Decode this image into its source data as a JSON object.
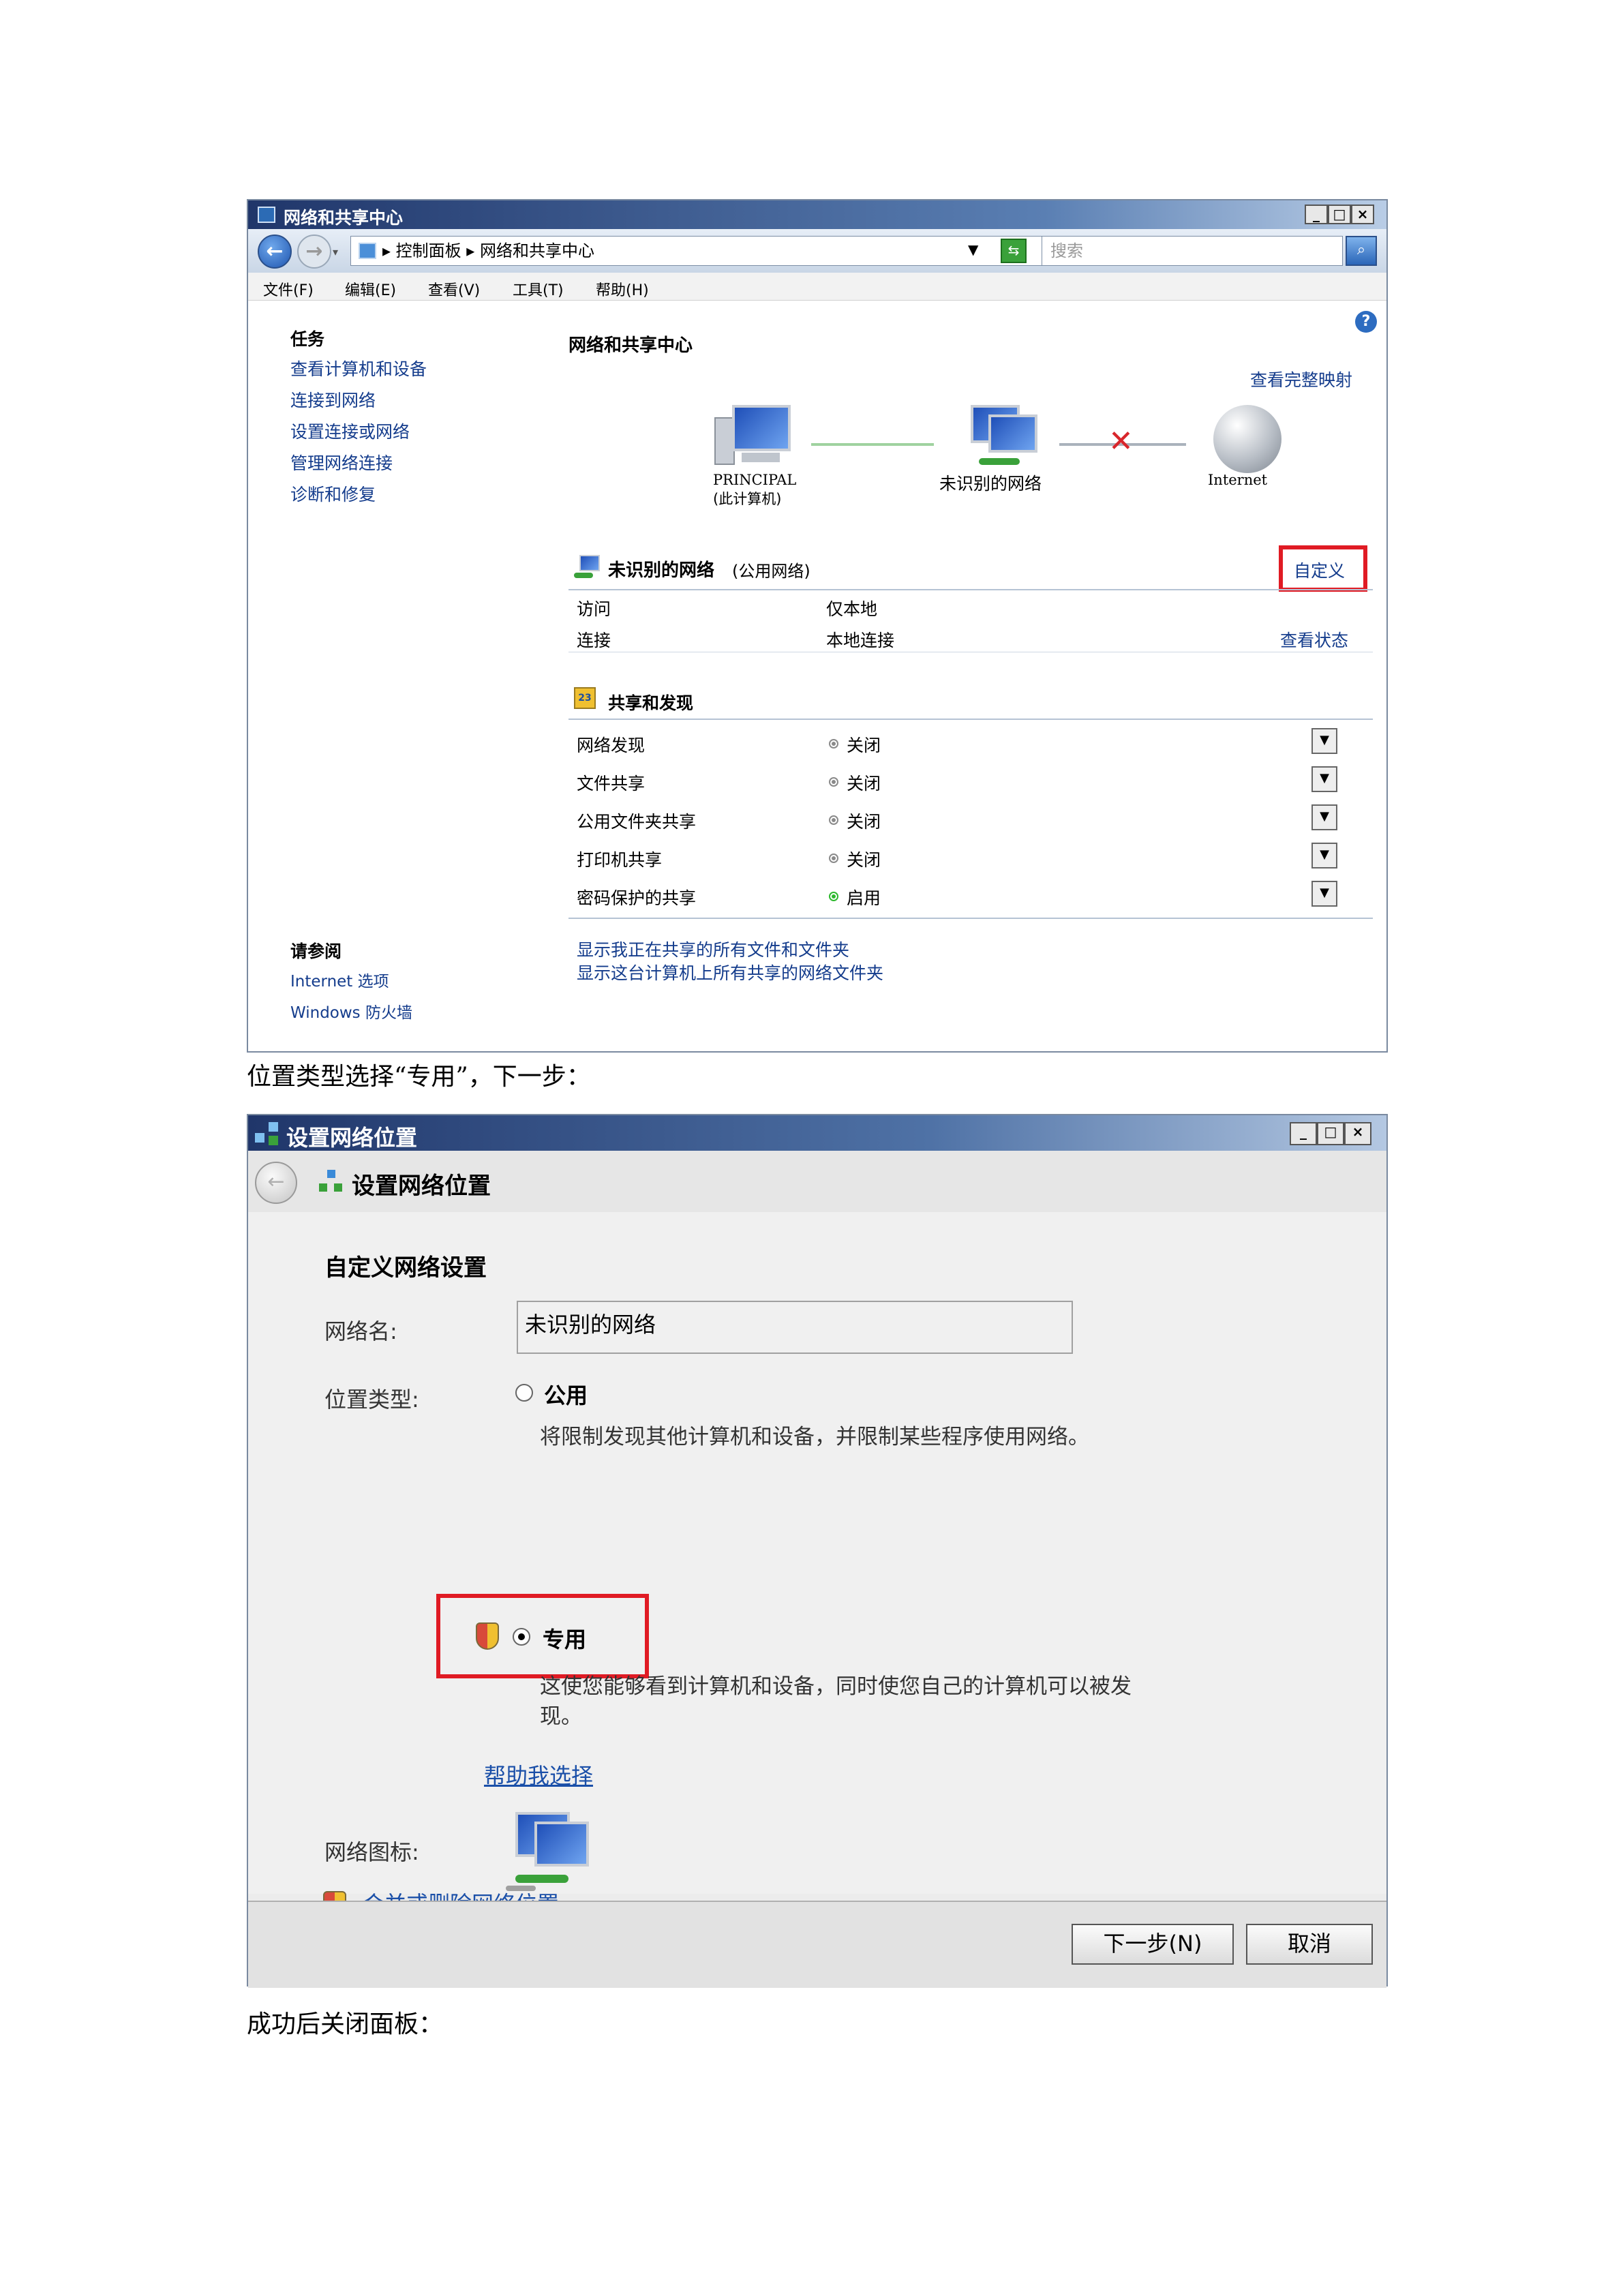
{
  "window1": {
    "title": "网络和共享中心",
    "address_path": "▸ 控制面板 ▸ 网络和共享中心",
    "search_placeholder": "搜索",
    "menu": [
      "文件(F)",
      "编辑(E)",
      "查看(V)",
      "工具(T)",
      "帮助(H)"
    ],
    "tasks_heading": "任务",
    "tasks": [
      "查看计算机和设备",
      "连接到网络",
      "设置连接或网络",
      "管理网络连接",
      "诊断和修复"
    ],
    "main_heading": "网络和共享中心",
    "view_full_map": "查看完整映射",
    "map": {
      "computer_name": "PRINCIPAL",
      "computer_sub": "(此计算机)",
      "network": "未识别的网络",
      "internet": "Internet"
    },
    "network_section": {
      "name": "未识别的网络",
      "type": "(公用网络)",
      "customize": "自定义",
      "rows": [
        {
          "label": "访问",
          "value": "仅本地",
          "action": ""
        },
        {
          "label": "连接",
          "value": "本地连接",
          "action": "查看状态"
        }
      ]
    },
    "sharing_section": {
      "heading": "共享和发现",
      "rows": [
        {
          "label": "网络发现",
          "status": "关闭",
          "color": "#8a8a8a"
        },
        {
          "label": "文件共享",
          "status": "关闭",
          "color": "#8a8a8a"
        },
        {
          "label": "公用文件夹共享",
          "status": "关闭",
          "color": "#8a8a8a"
        },
        {
          "label": "打印机共享",
          "status": "关闭",
          "color": "#8a8a8a"
        },
        {
          "label": "密码保护的共享",
          "status": "启用",
          "color": "#2db82d"
        }
      ]
    },
    "see_also_heading": "请参阅",
    "see_also": [
      "Internet 选项",
      "Windows 防火墙"
    ],
    "bottom_links": [
      "显示我正在共享的所有文件和文件夹",
      "显示这台计算机上所有共享的网络文件夹"
    ]
  },
  "caption1": "位置类型选择“专用”，下一步：",
  "window2": {
    "title": "设置网络位置",
    "header_title": "设置网络位置",
    "section_title": "自定义网络设置",
    "network_name_label": "网络名:",
    "network_name_value": "未识别的网络",
    "location_type_label": "位置类型:",
    "public_label": "公用",
    "public_desc": "将限制发现其他计算机和设备，并限制某些程序使用网络。",
    "private_label": "专用",
    "private_desc_line1": "这使您能够看到计算机和设备，同时使您自己的计算机可以被发",
    "private_desc_line2": "现。",
    "help_link": "帮助我选择",
    "network_icon_label": "网络图标:",
    "merge_link": "合并或删除网络位置",
    "next_button": "下一步(N)",
    "cancel_button": "取消"
  },
  "caption2": "成功后关闭面板：",
  "colors": {
    "highlight": "#e01b24",
    "link": "#143c8c"
  }
}
